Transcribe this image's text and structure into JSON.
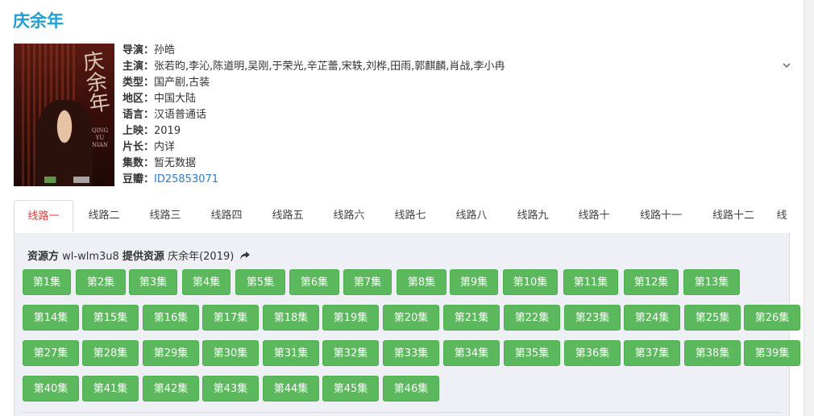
{
  "title": "庆余年",
  "info": {
    "director_label": "导演：",
    "director": "孙皓",
    "cast_label": "主演：",
    "cast": "张若昀,李沁,陈道明,吴刚,于荣光,辛芷蕾,宋轶,刘桦,田雨,郭麒麟,肖战,李小冉",
    "type_label": "类型：",
    "type": "国产剧,古装",
    "region_label": "地区：",
    "region": "中国大陆",
    "language_label": "语言：",
    "language": "汉语普通话",
    "release_label": "上映：",
    "release": "2019",
    "length_label": "片长：",
    "length": "内详",
    "episodes_label": "集数：",
    "episodes": "暂无数据",
    "douban_label": "豆瓣：",
    "douban": "ID25853071"
  },
  "poster": {
    "calligraphy": "庆余年",
    "english": "QING YU NIAN"
  },
  "expand_icon": "chevron-down-icon",
  "tabs": [
    "线路一",
    "线路二",
    "线路三",
    "线路四",
    "线路五",
    "线路六",
    "线路七",
    "线路八",
    "线路九",
    "线路十",
    "线路十一",
    "线路十二",
    "线"
  ],
  "active_tab": 0,
  "source": {
    "label": "资源方",
    "value": "wl-wlm3u8",
    "provider_label": "提供资源",
    "provider": "庆余年(2019)",
    "share_icon": "share-arrow-icon"
  },
  "episode_list": [
    "第1集",
    "第2集",
    "第3集",
    "第4集",
    "第5集",
    "第6集",
    "第7集",
    "第8集",
    "第9集",
    "第10集",
    "第11集",
    "第12集",
    "第13集",
    "第14集",
    "第15集",
    "第16集",
    "第17集",
    "第18集",
    "第19集",
    "第20集",
    "第21集",
    "第22集",
    "第23集",
    "第24集",
    "第25集",
    "第26集",
    "第27集",
    "第28集",
    "第29集",
    "第30集",
    "第31集",
    "第32集",
    "第33集",
    "第34集",
    "第35集",
    "第36集",
    "第37集",
    "第38集",
    "第39集",
    "第40集",
    "第41集",
    "第42集",
    "第43集",
    "第44集",
    "第45集",
    "第46集"
  ],
  "colors": {
    "title": "#1e9fd6",
    "active_tab": "#e23c3c",
    "episode_button": "#5cb85c",
    "link": "#2e7bd3"
  }
}
